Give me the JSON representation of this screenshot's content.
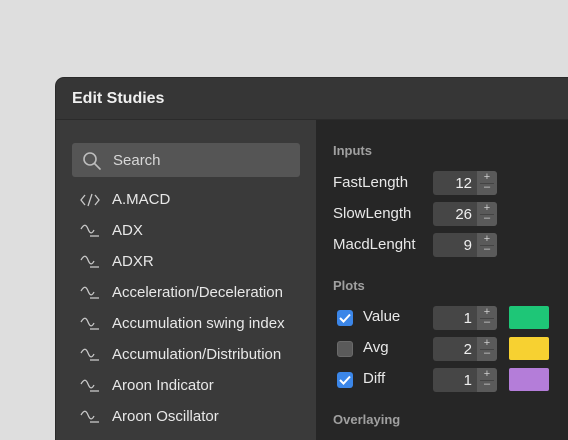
{
  "window": {
    "title": "Edit Studies"
  },
  "search": {
    "placeholder": "Search"
  },
  "studies": [
    {
      "label": "A.MACD",
      "icon": "code-icon"
    },
    {
      "label": "ADX",
      "icon": "wave-icon"
    },
    {
      "label": "ADXR",
      "icon": "wave-icon"
    },
    {
      "label": "Acceleration/Deceleration",
      "icon": "wave-icon"
    },
    {
      "label": "Accumulation swing index",
      "icon": "wave-icon"
    },
    {
      "label": "Accumulation/Distribution",
      "icon": "wave-icon"
    },
    {
      "label": "Aroon Indicator",
      "icon": "wave-icon"
    },
    {
      "label": "Aroon Oscillator",
      "icon": "wave-icon"
    }
  ],
  "inputs": {
    "section_label": "Inputs",
    "rows": [
      {
        "label": "FastLength",
        "value": "12"
      },
      {
        "label": "SlowLength",
        "value": "26"
      },
      {
        "label": "MacdLenght",
        "value": "9"
      }
    ]
  },
  "plots": {
    "section_label": "Plots",
    "rows": [
      {
        "label": "Value",
        "checked": true,
        "value": "1",
        "color": "#1ec677"
      },
      {
        "label": "Avg",
        "checked": false,
        "value": "2",
        "color": "#f7d131"
      },
      {
        "label": "Diff",
        "checked": true,
        "value": "1",
        "color": "#b47dd9"
      }
    ]
  },
  "overlaying": {
    "section_label": "Overlaying"
  },
  "stepper": {
    "up": "+",
    "down": "–"
  }
}
